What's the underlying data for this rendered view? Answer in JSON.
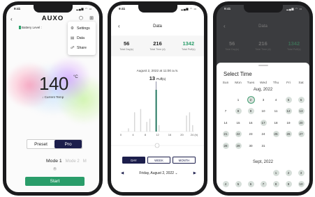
{
  "status_bar": {
    "time": "9:41",
    "icons": "▂▄▆ ◠ ▭"
  },
  "phone1": {
    "logo": "AUXO",
    "battery_label": "Battery Level :",
    "back_icon": "back-chevron",
    "menu": [
      {
        "label": "Settings",
        "icon": "⚙"
      },
      {
        "label": "Data",
        "icon": "▤"
      },
      {
        "label": "Share",
        "icon": "☍"
      }
    ],
    "temperature": "140",
    "temperature_unit": "°C",
    "temperature_label": "↓ Current Temp",
    "modes_tabs": [
      "Preset",
      "Pro"
    ],
    "active_tab": "Pro",
    "mode_active": "Mode 1",
    "mode_next": "Mode 2",
    "mode_next2": "M",
    "mode_dot": "+",
    "start_label": "Start",
    "colors": {
      "accent": "#2a9d6a",
      "selected_tab": "#1c1e4c"
    }
  },
  "phone2": {
    "title": "Data",
    "stats": [
      {
        "value": "56",
        "label": "Total Day(s)"
      },
      {
        "value": "216",
        "label": "Total Time (d)"
      },
      {
        "value": "1342",
        "label": "Total Puff(s)"
      }
    ],
    "chart_date": "August 2, 2022 at 11:00 a.m.",
    "puffs_value": "13",
    "puffs_unit": "Puff(s)",
    "range_tabs": [
      "DAY",
      "WEEK",
      "MONTH"
    ],
    "active_range": "DAY",
    "date_label": "Friday, August 2, 2022",
    "date_caret": "⌄"
  },
  "phone3": {
    "title": "Data",
    "stats": [
      {
        "value": "56",
        "label": "Total Day(s)"
      },
      {
        "value": "216",
        "label": "Total Time (d)"
      },
      {
        "value": "1342",
        "label": "Total Puff(s)"
      }
    ],
    "sheet_title": "Select Time",
    "weekdays": [
      "Sun",
      "Mon",
      "Tues",
      "Wed",
      "Thu",
      "Fri",
      "Sat"
    ],
    "month1": {
      "label": "Aug, 2022",
      "lead_blanks": 1,
      "days": [
        "1",
        "2",
        "3",
        "4",
        "5",
        "6",
        "7",
        "8",
        "9",
        "10",
        "11",
        "12",
        "13",
        "14",
        "15",
        "16",
        "17",
        "18",
        "19",
        "20",
        "21",
        "22",
        "23",
        "24",
        "25",
        "26",
        "27",
        "28",
        "29",
        "30",
        "31"
      ],
      "circled": [
        2,
        5,
        6,
        8,
        9,
        12,
        13,
        17,
        20,
        21,
        22,
        25,
        26,
        27,
        28,
        29
      ],
      "selected": 2
    },
    "month2": {
      "label": "Sept, 2022",
      "lead_blanks": 4,
      "days": [
        "1",
        "2",
        "3",
        "4",
        "5",
        "6",
        "7",
        "8",
        "9",
        "10"
      ],
      "circled": [
        1,
        2,
        3,
        4,
        5,
        6,
        7,
        8,
        9,
        10
      ],
      "selected": 0
    }
  },
  "chart_data": {
    "type": "bar",
    "x_ticks": [
      "0",
      "4",
      "8",
      "12",
      "16",
      "20",
      "24 (h)"
    ],
    "selected_hour": 11,
    "values": [
      0,
      0,
      1,
      0,
      6,
      0,
      7,
      0,
      3,
      4,
      0,
      13,
      2,
      0,
      0,
      0,
      0,
      0,
      0,
      0,
      0,
      5,
      6,
      2
    ]
  }
}
